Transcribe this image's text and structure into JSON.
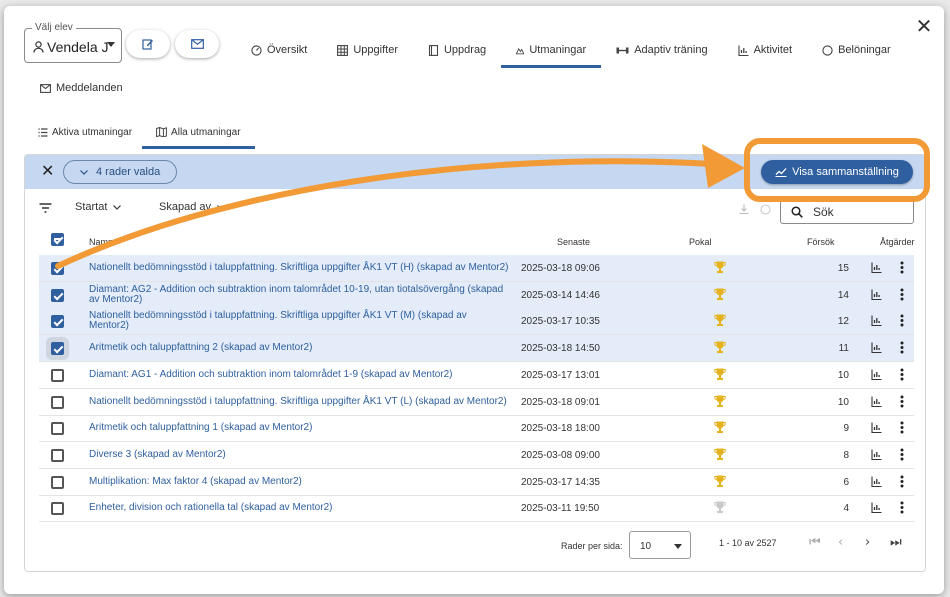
{
  "student": {
    "legend": "Välj elev",
    "name": "Vendela J"
  },
  "tabs": [
    {
      "label": "Översikt",
      "icon": "speedometer-icon"
    },
    {
      "label": "Uppgifter",
      "icon": "grid-icon"
    },
    {
      "label": "Uppdrag",
      "icon": "book-icon"
    },
    {
      "label": "Utmaningar",
      "icon": "climber-icon",
      "active": true
    },
    {
      "label": "Adaptiv träning",
      "icon": "dumbbell-icon"
    },
    {
      "label": "Aktivitet",
      "icon": "chart-icon"
    },
    {
      "label": "Belöningar",
      "icon": "badge-icon"
    }
  ],
  "tab_messages": {
    "label": "Meddelanden"
  },
  "subtabs": [
    {
      "label": "Aktiva utmaningar"
    },
    {
      "label": "Alla utmaningar",
      "active": true
    }
  ],
  "selection": {
    "count_label": "4 rader valda",
    "summary_label": "Visa sammanställning"
  },
  "filters": {
    "sort1": "Startat",
    "sort2": "Skapad av",
    "search_placeholder": "Sök"
  },
  "columns": {
    "name": "Namn",
    "latest": "Senaste",
    "trophy": "Pokal",
    "attempts": "Försök",
    "actions": "Åtgärder"
  },
  "rows": [
    {
      "name": "Nationellt bedömningsstöd i taluppfattning. Skriftliga uppgifter ÅK1 VT (H) (skapad av Mentor2)",
      "date": "2025-03-18 09:06",
      "tries": "15",
      "selected": true,
      "trophy": "gold"
    },
    {
      "name": "Diamant: AG2 - Addition och subtraktion inom talområdet 10-19, utan tiotalsövergång (skapad av Mentor2)",
      "date": "2025-03-14 14:46",
      "tries": "14",
      "selected": true,
      "trophy": "gold"
    },
    {
      "name": "Nationellt bedömningsstöd i taluppfattning. Skriftliga uppgifter ÅK1 VT (M) (skapad av Mentor2)",
      "date": "2025-03-17 10:35",
      "tries": "12",
      "selected": true,
      "trophy": "gold"
    },
    {
      "name": "Aritmetik och taluppfattning 2 (skapad av Mentor2)",
      "date": "2025-03-18 14:50",
      "tries": "11",
      "selected": true,
      "trophy": "gold"
    },
    {
      "name": "Diamant: AG1 - Addition och subtraktion inom talområdet 1-9 (skapad av Mentor2)",
      "date": "2025-03-17 13:01",
      "tries": "10",
      "selected": false,
      "trophy": "gold"
    },
    {
      "name": "Nationellt bedömningsstöd i taluppfattning. Skriftliga uppgifter ÅK1 VT (L) (skapad av Mentor2)",
      "date": "2025-03-18 09:01",
      "tries": "10",
      "selected": false,
      "trophy": "gold"
    },
    {
      "name": "Aritmetik och taluppfattning 1 (skapad av Mentor2)",
      "date": "2025-03-18 18:00",
      "tries": "9",
      "selected": false,
      "trophy": "gold"
    },
    {
      "name": "Diverse 3 (skapad av Mentor2)",
      "date": "2025-03-08 09:00",
      "tries": "8",
      "selected": false,
      "trophy": "gold"
    },
    {
      "name": "Multiplikation: Max faktor 4 (skapad av Mentor2)",
      "date": "2025-03-17 14:35",
      "tries": "6",
      "selected": false,
      "trophy": "gold"
    },
    {
      "name": "Enheter, division och rationella tal (skapad av Mentor2)",
      "date": "2025-03-11 19:50",
      "tries": "4",
      "selected": false,
      "trophy": "silver"
    }
  ],
  "pagination": {
    "rows_per_page_label": "Rader per sida:",
    "rows_per_page": "10",
    "range": "1 - 10 av 2527"
  },
  "colors": {
    "accent": "#2f5f9e",
    "selection_bar": "#c5d7f1",
    "annotation": "#f19a36",
    "gold": "#e3b21c",
    "silver": "#c9c9c9"
  }
}
